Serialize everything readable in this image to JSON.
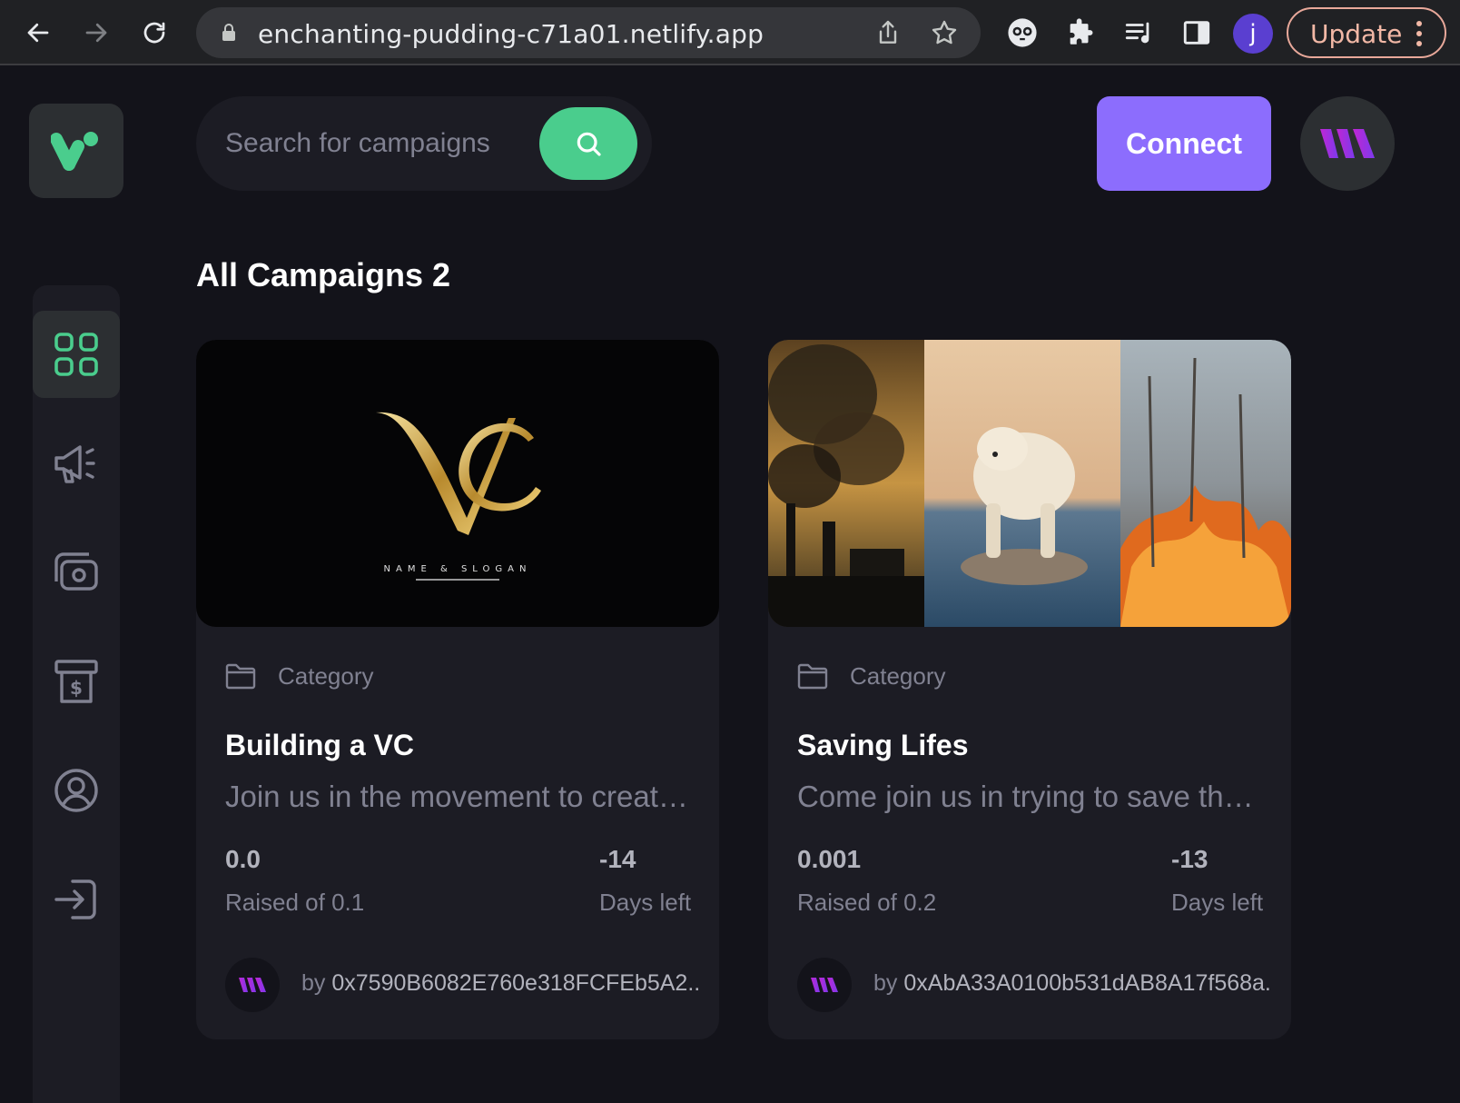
{
  "browser": {
    "url": "enchanting-pudding-c71a01.netlify.app",
    "profile_initial": "j",
    "update_label": "Update"
  },
  "search": {
    "placeholder": "Search for campaigns",
    "value": ""
  },
  "header": {
    "connect_label": "Connect"
  },
  "page": {
    "title": "All Campaigns 2"
  },
  "sidebar": {
    "items": [
      {
        "icon": "dashboard-icon",
        "active": true
      },
      {
        "icon": "campaign-megaphone-icon",
        "active": false
      },
      {
        "icon": "payment-icon",
        "active": false
      },
      {
        "icon": "withdraw-icon",
        "active": false
      },
      {
        "icon": "profile-icon",
        "active": false
      },
      {
        "icon": "logout-icon",
        "active": false
      }
    ]
  },
  "campaigns": [
    {
      "category": "Category",
      "title": "Building a VC",
      "description": "Join us in the movement to create a VC",
      "raised": "0.0",
      "raised_label": "Raised of 0.1",
      "days": "-14",
      "days_label": "Days left",
      "owner_prefix": "by",
      "owner": "0x7590B6082E760e318FCFEb5A2...",
      "logo_text": "NAME & SLOGAN"
    },
    {
      "category": "Category",
      "title": "Saving Lifes",
      "description": "Come join us in trying to save the planet",
      "raised": "0.001",
      "raised_label": "Raised of 0.2",
      "days": "-13",
      "days_label": "Days left",
      "owner_prefix": "by",
      "owner": "0xAbA33A0100b531dAB8A17f568a..."
    }
  ],
  "colors": {
    "accent_green": "#4acd8d",
    "accent_purple": "#8c6dfd",
    "background": "#13131a",
    "card": "#1c1c24",
    "muted_text": "#808191"
  }
}
